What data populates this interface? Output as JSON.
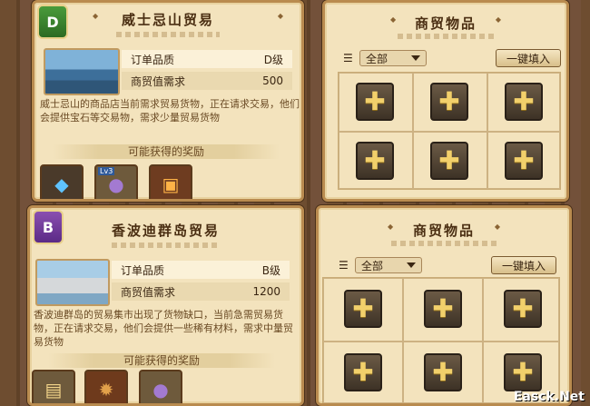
{
  "trades": [
    {
      "title": "威士忌山贸易",
      "badge": "D",
      "quality_label": "订单品质",
      "quality_value": "D级",
      "need_label": "商贸值需求",
      "need_value": "500",
      "description": "威士忌山的商品店当前需求贸易货物，正在请求交易，他们会提供宝石等交易物，需求少量贸易货物",
      "rewards_heading": "可能获得的奖励",
      "rewards": [
        {
          "icon": "blue-gem-icon",
          "glyph": "◆"
        },
        {
          "icon": "purple-bag-icon",
          "glyph": "●",
          "badge": "Lv3"
        },
        {
          "icon": "red-book-icon",
          "glyph": "▣"
        }
      ],
      "goods": {
        "title": "商贸物品",
        "filter_value": "全部",
        "fill_label": "一键填入",
        "slots": 6
      }
    },
    {
      "title": "香波迪群岛贸易",
      "badge": "B",
      "quality_label": "订单品质",
      "quality_value": "B级",
      "need_label": "商贸值需求",
      "need_value": "1200",
      "description": "香波迪群岛的贸易集市出现了货物缺口，当前急需贸易货物，正在请求交易，他们会提供一些稀有材料，需求中量贸易货物",
      "rewards_heading": "可能获得的奖励",
      "rewards": [
        {
          "icon": "scroll-map-icon",
          "glyph": "▤"
        },
        {
          "icon": "treasure-chest-icon",
          "glyph": "✹"
        },
        {
          "icon": "purple-bag-icon",
          "glyph": "●"
        }
      ],
      "goods": {
        "title": "商贸物品",
        "filter_value": "全部",
        "fill_label": "一键填入",
        "slots": 6
      }
    }
  ],
  "watermark": "Easck.Net"
}
